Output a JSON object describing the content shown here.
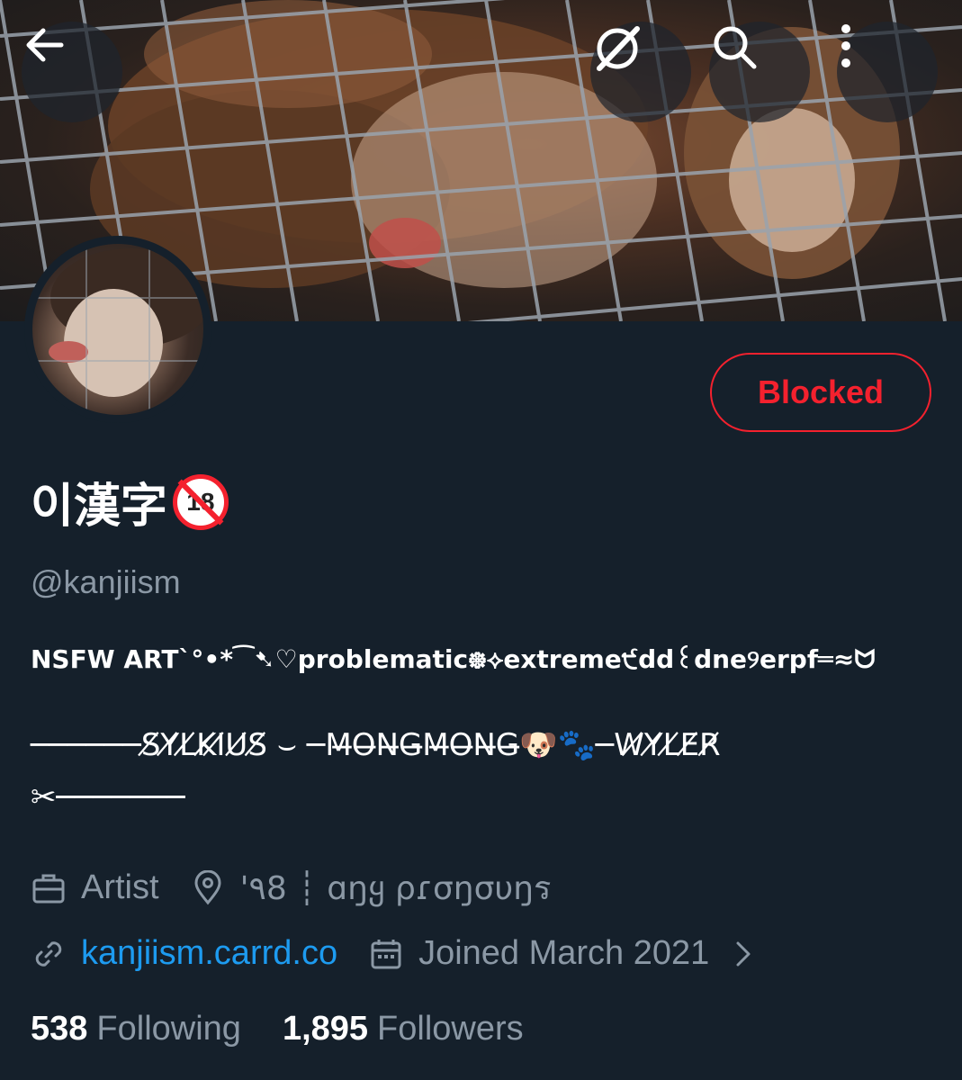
{
  "header": {
    "back_icon": "arrow-left-icon",
    "action_icons": [
      "grok-icon",
      "search-icon",
      "more-vertical-icon"
    ]
  },
  "profile": {
    "display_name": "이漢字",
    "name_emoji": "18",
    "handle": "@kanjiism",
    "relationship_button": "Blocked",
    "bio": {
      "line1": "NSFW ART`°•*⁀➷♡problematic᪥⟡extreme੯dd꒰dne୨erpf═≈ᗢ",
      "line2": "──────S̸Y̸L̸K̸I̸U̸S̸ ⌣ ─M̶O̶N̶G̶M̶O̶N̶G̶🐶🐾─W̸Y̸L̸E̸R̸",
      "line3": "✂───────"
    },
    "profession": "Artist",
    "location": "'٩8 ┊ ɑŋყ ρɾσŋσυŋร",
    "website": "kanjiism.carrd.co",
    "joined": "Joined March 2021",
    "following_count": "538",
    "following_label": "Following",
    "followers_count": "1,895",
    "followers_label": "Followers"
  },
  "colors": {
    "background": "#15202b",
    "blocked_red": "#f4212e",
    "link_blue": "#1d9bf0",
    "muted_text": "#8b98a5"
  }
}
